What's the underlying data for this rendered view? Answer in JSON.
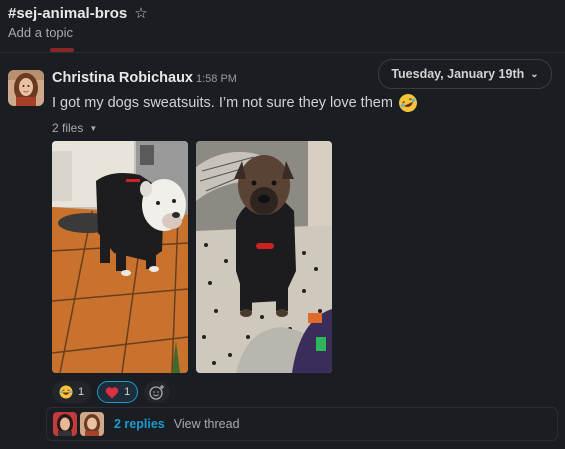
{
  "channel": {
    "name": "#sej-animal-bros",
    "topic_placeholder": "Add a topic"
  },
  "date_divider": {
    "label": "Tuesday, January 19th"
  },
  "message": {
    "author": "Christina Robichaux",
    "time": "1:58 PM",
    "text": "I got my dogs sweatsuits. I’m not sure they love them",
    "files_label": "2 files"
  },
  "reactions": [
    {
      "emoji": "joy-emoji",
      "count": "1"
    },
    {
      "emoji": "heart-emoji",
      "count": "1"
    }
  ],
  "thread": {
    "replies": "2 replies",
    "view": "View thread"
  },
  "colors": {
    "background": "#1a1d21",
    "link": "#1d9bd1",
    "text": "#d1d2d3"
  },
  "icons": [
    "star-icon",
    "chevron-down-icon",
    "rofl-emoji",
    "caret-down-icon",
    "add-reaction-icon"
  ]
}
